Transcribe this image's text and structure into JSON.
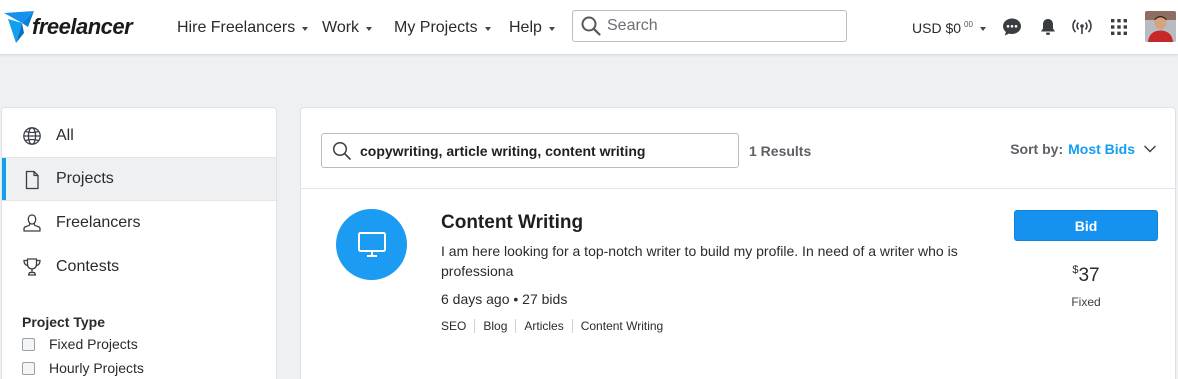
{
  "nav": {
    "logo_text": "freelancer",
    "menus": [
      {
        "label": "Hire Freelancers"
      },
      {
        "label": "Work"
      },
      {
        "label": "My Projects"
      },
      {
        "label": "Help"
      }
    ],
    "search_placeholder": "Search",
    "balance_currency": "USD",
    "balance_amount": "$0",
    "balance_cents": "00",
    "icons": [
      "chat-icon",
      "bell-icon",
      "broadcast-icon",
      "apps-grid-icon"
    ],
    "brand_color": "#139ff0"
  },
  "sidebar": {
    "items": [
      {
        "label": "All",
        "icon": "globe-icon",
        "active": false
      },
      {
        "label": "Projects",
        "icon": "document-icon",
        "active": true
      },
      {
        "label": "Freelancers",
        "icon": "user-icon",
        "active": false
      },
      {
        "label": "Contests",
        "icon": "trophy-icon",
        "active": false
      }
    ],
    "project_type": {
      "title": "Project Type",
      "options": [
        {
          "label": "Fixed Projects",
          "checked": false
        },
        {
          "label": "Hourly Projects",
          "checked": false
        }
      ]
    }
  },
  "main": {
    "query": "copywriting, article writing, content writing",
    "results_text": "1 Results",
    "sort_label": "Sort by:",
    "sort_value": "Most Bids",
    "project": {
      "title": "Content Writing",
      "description": "I am here looking for a top-notch writer to build my profile. In need of a writer who is professiona",
      "meta": "6 days ago • 27 bids",
      "tags": [
        "SEO",
        "Blog",
        "Articles",
        "Content Writing"
      ],
      "icon": "monitor-icon",
      "bid_label": "Bid",
      "price_currency": "$",
      "price_value": "37",
      "price_type": "Fixed"
    }
  }
}
